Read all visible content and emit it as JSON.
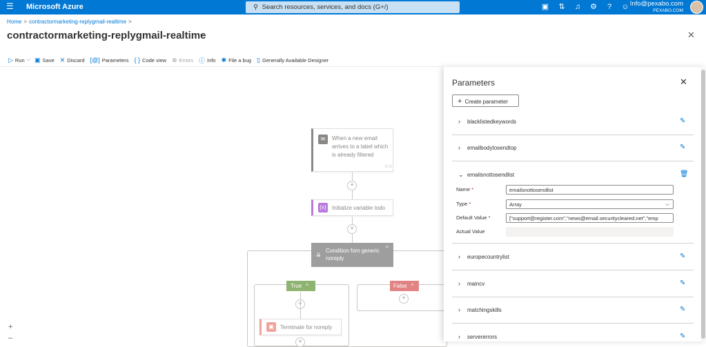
{
  "topbar": {
    "menu_icon": "hamburger-icon",
    "brand": "Microsoft Azure",
    "search_placeholder": "Search resources, services, and docs (G+/)",
    "icons": [
      "cloud-shell-icon",
      "directory-filter-icon",
      "bell-icon",
      "gear-icon",
      "help-icon",
      "feedback-icon"
    ],
    "account_email": "Info@pexabo.com",
    "account_org": "PEXABO.COM"
  },
  "breadcrumb": {
    "home": "Home",
    "item": "contractormarketing-replygmail-realtime",
    "separator": ">"
  },
  "page": {
    "title": "contractormarketing-replygmail-realtime",
    "more": "···",
    "close": "✕"
  },
  "toolbar": {
    "run": "Run",
    "save": "Save",
    "discard": "Discard",
    "parameters": "Parameters",
    "code_view": "Code view",
    "errors": "Errors",
    "info": "Info",
    "file_bug": "File a bug",
    "ga_designer": "Generally Available Designer"
  },
  "designer": {
    "trigger_label": "When a new email arrives to a label which is already filtered",
    "init_label": "Initialize variable todo",
    "condition_label": "Condition fom generic noreply",
    "true_label": "True",
    "false_label": "False",
    "terminate_label": "Terminate for noreply",
    "zoom_in": "+",
    "zoom_out": "–"
  },
  "panel": {
    "title": "Parameters",
    "create_button": "Create parameter",
    "params": [
      {
        "name": "blacklistedkeywords"
      },
      {
        "name": "emailbodytosendtop"
      },
      {
        "name": "emailsnottosendlist"
      },
      {
        "name": "europecountrylist"
      },
      {
        "name": "maincv"
      },
      {
        "name": "matchingskills"
      },
      {
        "name": "servererrors"
      }
    ],
    "expanded": {
      "name_label": "Name",
      "name_value": "emailsnottosendlist",
      "type_label": "Type",
      "type_value": "Array",
      "default_label": "Default Value",
      "default_value": "[\"support@register.com\",\"news@email.securitycleared.net\",\"emp",
      "actual_label": "Actual Value",
      "actual_value": ""
    }
  },
  "colors": {
    "azure_blue": "#0078d4",
    "true_branch": "#8fb371",
    "false_branch": "#e28383",
    "condition": "#9e9e9e",
    "variable": "#b978e0",
    "terminate": "#f0a39c",
    "delete_icon": "#0078d4"
  }
}
